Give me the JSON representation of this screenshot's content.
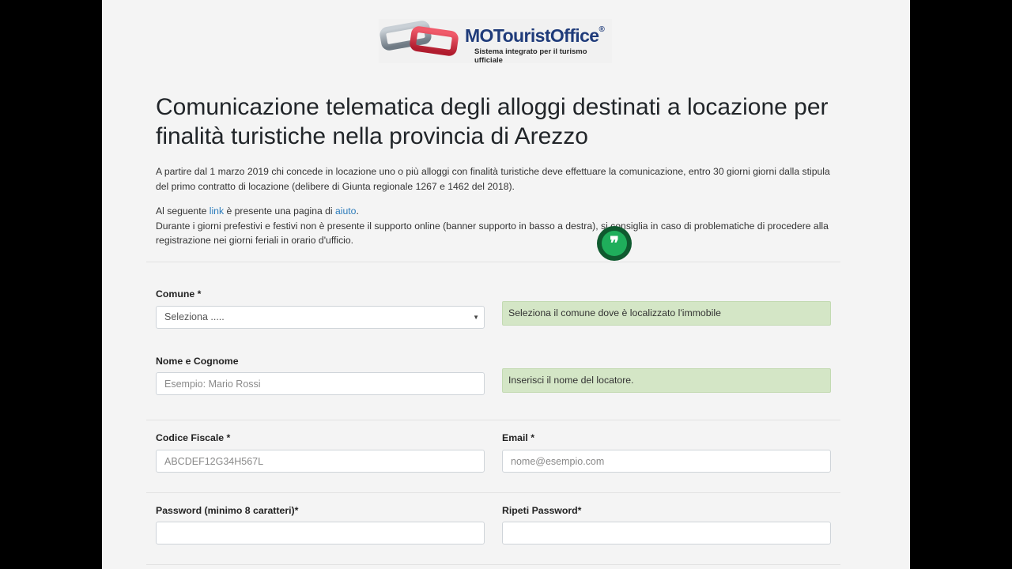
{
  "logo": {
    "title": "MOTouristOffice",
    "registered": "®",
    "subtitle": "Sistema integrato per il turismo ufficiale"
  },
  "heading": "Comunicazione telematica degli alloggi destinati a locazione per finalità turistiche nella provincia di Arezzo",
  "intro": "A partire dal 1 marzo 2019 chi concede in locazione uno o più alloggi con finalità turistiche deve effettuare la comunicazione, entro 30 giorni giorni dalla stipula del primo contratto di locazione (delibere di Giunta regionale 1267 e 1462 del 2018).",
  "info": {
    "prefix": "Al seguente ",
    "link_label": "link",
    "middle": " è presente una pagina di ",
    "help_label": "aiuto",
    "suffix": ".",
    "notice": "Durante i giorni prefestivi e festivi non è presente il supporto online (banner supporto in basso a destra), si consiglia in caso di problematiche di procedere alla registrazione nei giorni feriali in orario d'ufficio."
  },
  "form": {
    "comune": {
      "label": "Comune *",
      "selected": "Seleziona .....",
      "arrow": "▼",
      "hint": "Seleziona il comune dove è localizzato l'immobile"
    },
    "nome": {
      "label": "Nome e Cognome",
      "placeholder": "Esempio: Mario Rossi",
      "hint": "Inserisci il nome del locatore."
    },
    "codice_fiscale": {
      "label": "Codice Fiscale *",
      "placeholder": "ABCDEF12G34H567L"
    },
    "email": {
      "label": "Email *",
      "placeholder": "nome@esempio.com"
    },
    "password": {
      "label": "Password (minimo 8 caratteri)*",
      "value": ""
    },
    "repeat_password": {
      "label": "Ripeti Password*",
      "value": ""
    }
  },
  "chat_widget": {
    "icon": "quote-chat-icon",
    "glyph": "❞"
  },
  "colors": {
    "link": "#2b7bbb",
    "hint_bg": "#d4e6c6",
    "chat": "#1fae5b"
  }
}
